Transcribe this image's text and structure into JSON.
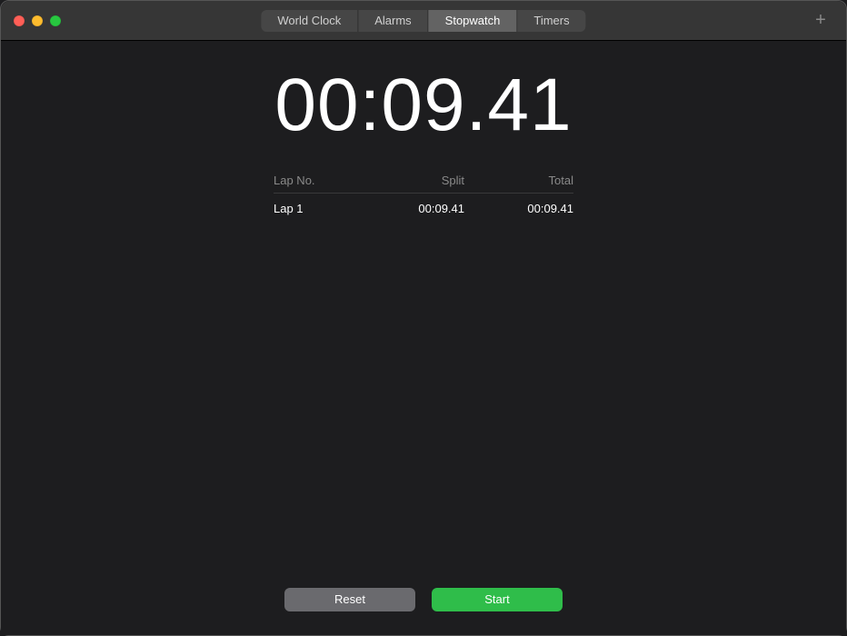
{
  "tabs": {
    "world_clock": "World Clock",
    "alarms": "Alarms",
    "stopwatch": "Stopwatch",
    "timers": "Timers",
    "active": "stopwatch"
  },
  "stopwatch": {
    "elapsed": "00:09.41",
    "columns": {
      "lap_no": "Lap No.",
      "split": "Split",
      "total": "Total"
    },
    "laps": [
      {
        "label": "Lap 1",
        "split": "00:09.41",
        "total": "00:09.41"
      }
    ],
    "buttons": {
      "reset": "Reset",
      "start": "Start"
    }
  },
  "icons": {
    "plus": "+"
  }
}
